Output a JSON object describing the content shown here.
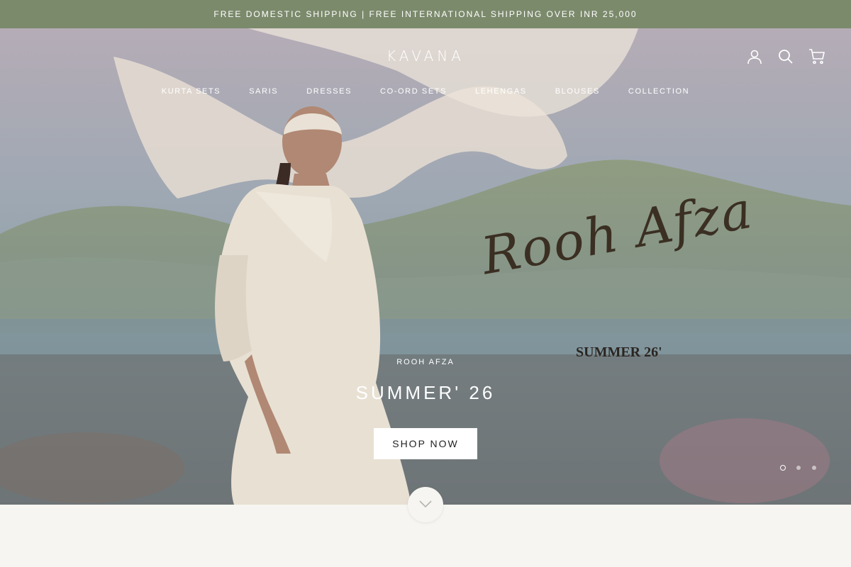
{
  "announcement": "FREE DOMESTIC SHIPPING | FREE INTERNATIONAL SHIPPING OVER INR 25,000",
  "header": {
    "logo": "KAVANA",
    "icons": [
      "account-icon",
      "search-icon",
      "cart-icon"
    ]
  },
  "nav": [
    {
      "label": "KURTA SETS"
    },
    {
      "label": "SARIS"
    },
    {
      "label": "DRESSES"
    },
    {
      "label": "CO-ORD SETS"
    },
    {
      "label": "LEHENGAS"
    },
    {
      "label": "BLOUSES"
    },
    {
      "label": "COLLECTION"
    }
  ],
  "hero": {
    "artwork_title": "Rooh Afza",
    "artwork_subtitle": "SUMMER 26'",
    "kicker": "ROOH AFZA",
    "headline": "SUMMER' 26",
    "button_label": "SHOP NOW",
    "slides": {
      "count": 3,
      "active": 1
    }
  },
  "scroll_icon": "chevron-down-icon",
  "colors": {
    "announcement_bg": "#7c8a6c",
    "page_bg": "#f6f5f1",
    "button_bg": "#ffffff",
    "text_light": "#ffffff"
  }
}
